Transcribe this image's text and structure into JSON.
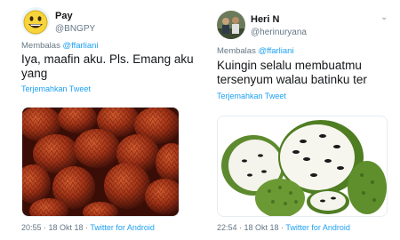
{
  "tweets": [
    {
      "name": "Pay",
      "handle": "@BNGPY",
      "reply_prefix": "Membalas ",
      "reply_to": "@ffarliani",
      "text_lines": [
        "Iya, maafin aku. Pls. Emang aku",
        "yang"
      ],
      "translate": "Terjemahkan Tweet",
      "time": "20:55 · 18 Okt 18 · ",
      "source": "Twitter for Android",
      "avatar_icon": "grinning-emoji-avatar",
      "media": "salak-fruit-photo"
    },
    {
      "name": "Heri N",
      "handle": "@herinuryana",
      "reply_prefix": "Membalas ",
      "reply_to": "@ffarliani",
      "text_lines": [
        "Kuingin selalu membuatmu",
        "tersenyum walau batinku ter"
      ],
      "translate": "Terjemahkan Tweet",
      "time": "22:54 · 18 Okt 18 · ",
      "source": "Twitter for Android",
      "avatar_icon": "group-photo-avatar",
      "media": "soursop-fruit-photo"
    }
  ],
  "colors": {
    "link": "#1da1f2",
    "muted": "#657786",
    "text": "#14171a"
  }
}
